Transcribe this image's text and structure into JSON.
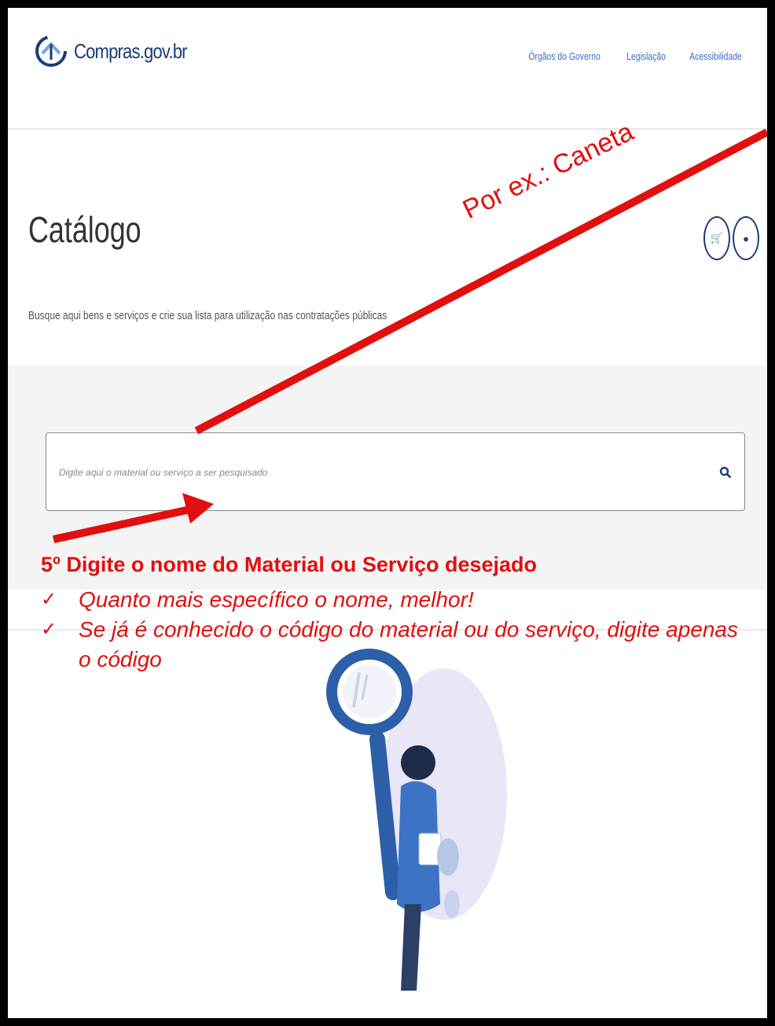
{
  "header": {
    "logo_text": "Compras.gov.br",
    "nav": [
      "Órgãos do Governo",
      "Legislação",
      "Acessibilidade"
    ]
  },
  "catalog": {
    "title": "Catálogo",
    "subtitle": "Busque aqui bens e serviços e crie sua lista para utilização nas contratações públicas"
  },
  "search": {
    "placeholder": "Digite aqui o material ou serviço a ser pesquisado",
    "icon": "search-icon"
  },
  "icons": {
    "cart": "cart-icon",
    "info": "info-icon",
    "logo": "compras-logo-icon"
  },
  "annotation": {
    "hint": "Por ex.: Caneta",
    "step": "5º Digite o nome do Material ou Serviço desejado",
    "tips": [
      "Quanto mais específico o nome, melhor!",
      "Se já é conhecido o código do material ou do serviço, digite apenas o código"
    ],
    "check_glyph": "✓",
    "color": "#e20f0f"
  },
  "colors": {
    "brand": "#1a3c7a",
    "link": "#3a6bbf",
    "annotation": "#e20f0f"
  }
}
